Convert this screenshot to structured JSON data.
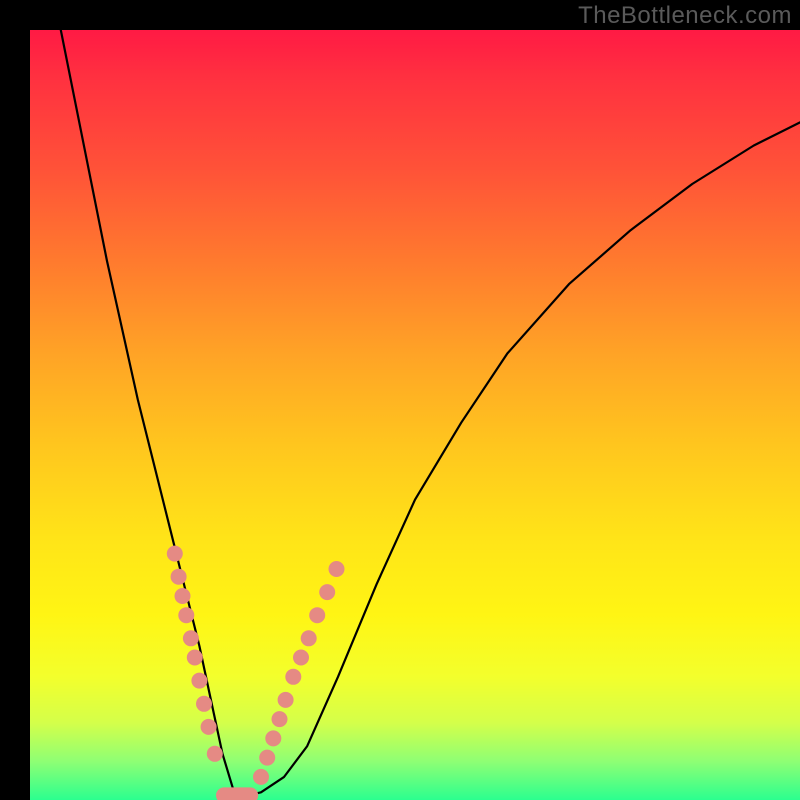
{
  "watermark": "TheBottleneck.com",
  "colors": {
    "curve": "#000000",
    "dot": "#e58a84",
    "gradient_top": "#ff1a44",
    "gradient_bottom": "#2bff8f",
    "frame": "#000000"
  },
  "chart_data": {
    "type": "line",
    "title": "",
    "xlabel": "",
    "ylabel": "",
    "xlim": [
      0,
      100
    ],
    "ylim": [
      0,
      100
    ],
    "grid": false,
    "legend": false,
    "series": [
      {
        "name": "bottleneck-curve",
        "x": [
          4,
          6,
          8,
          10,
          12,
          14,
          16,
          18,
          20,
          22,
          23.5,
          25,
          26.5,
          28,
          30,
          33,
          36,
          40,
          45,
          50,
          56,
          62,
          70,
          78,
          86,
          94,
          100
        ],
        "y": [
          100,
          90,
          80,
          70,
          61,
          52,
          44,
          36,
          28,
          20,
          13,
          6,
          1,
          0.5,
          1,
          3,
          7,
          16,
          28,
          39,
          49,
          58,
          67,
          74,
          80,
          85,
          88
        ]
      }
    ],
    "points_left": [
      {
        "x": 18.8,
        "y": 32
      },
      {
        "x": 19.3,
        "y": 29
      },
      {
        "x": 19.8,
        "y": 26.5
      },
      {
        "x": 20.3,
        "y": 24
      },
      {
        "x": 20.9,
        "y": 21
      },
      {
        "x": 21.4,
        "y": 18.5
      },
      {
        "x": 22.0,
        "y": 15.5
      },
      {
        "x": 22.6,
        "y": 12.5
      },
      {
        "x": 23.2,
        "y": 9.5
      },
      {
        "x": 24.0,
        "y": 6
      }
    ],
    "points_right": [
      {
        "x": 30.0,
        "y": 3
      },
      {
        "x": 30.8,
        "y": 5.5
      },
      {
        "x": 31.6,
        "y": 8
      },
      {
        "x": 32.4,
        "y": 10.5
      },
      {
        "x": 33.2,
        "y": 13
      },
      {
        "x": 34.2,
        "y": 16
      },
      {
        "x": 35.2,
        "y": 18.5
      },
      {
        "x": 36.2,
        "y": 21
      },
      {
        "x": 37.3,
        "y": 24
      },
      {
        "x": 38.6,
        "y": 27
      },
      {
        "x": 39.8,
        "y": 30
      }
    ],
    "bottom_pill": {
      "x_start": 25.2,
      "x_end": 28.6,
      "y": 0.6
    }
  }
}
